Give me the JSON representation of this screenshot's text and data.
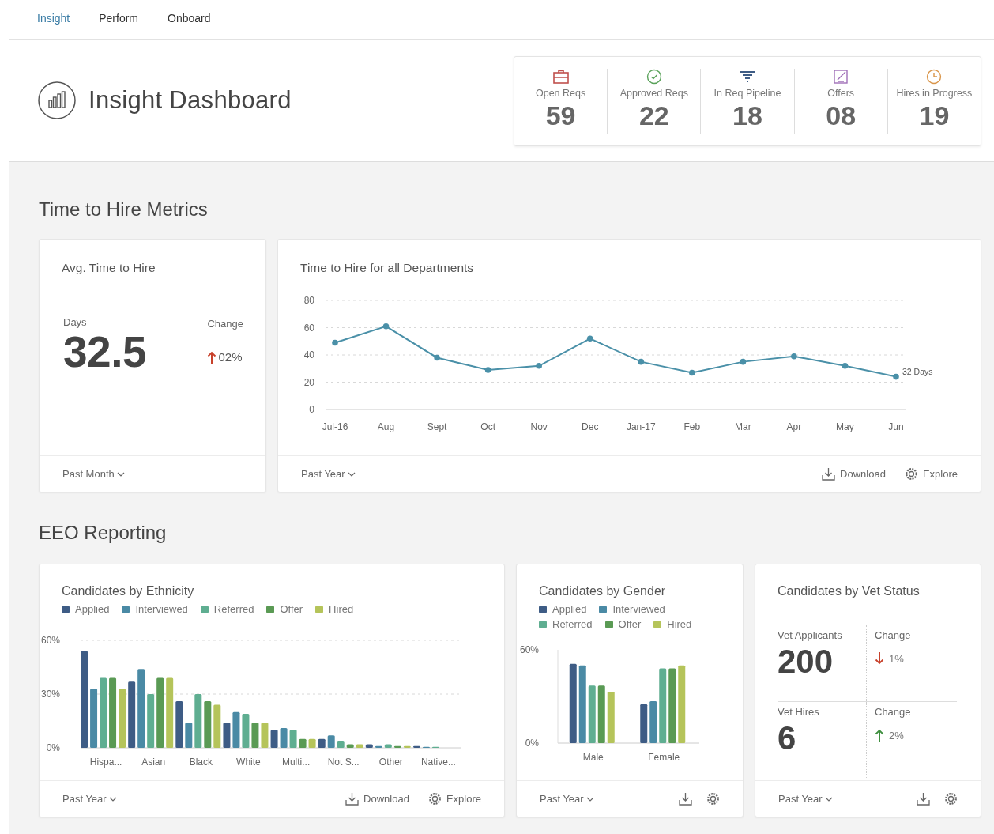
{
  "nav": {
    "tabs": [
      {
        "label": "Insight",
        "selected": true
      },
      {
        "label": "Perform",
        "selected": false
      },
      {
        "label": "Onboard",
        "selected": false
      }
    ]
  },
  "header": {
    "title": "Insight Dashboard"
  },
  "kpis": [
    {
      "label": "Open Reqs",
      "value": "59"
    },
    {
      "label": "Approved Reqs",
      "value": "22"
    },
    {
      "label": "In Req Pipeline",
      "value": "18"
    },
    {
      "label": "Offers",
      "value": "08"
    },
    {
      "label": "Hires in Progress",
      "value": "19"
    }
  ],
  "time_to_hire": {
    "heading": "Time to Hire Metrics",
    "avg": {
      "title": "Avg. Time to Hire",
      "value_label": "Days",
      "value": "32.5",
      "change_label": "Change",
      "change": "02%",
      "kind": "rise",
      "color": "#c8412b",
      "period": "Past Month"
    },
    "departments": {
      "title": "Time to Hire for all Departments",
      "period": "Past Year",
      "actions": [
        "Download",
        "Explore"
      ],
      "chart_data": {
        "type": "line",
        "categories": [
          "Jul-16",
          "Aug",
          "Sept",
          "Oct",
          "Nov",
          "Dec",
          "Jan-17",
          "Feb",
          "Mar",
          "Apr",
          "May",
          "Jun"
        ],
        "series": [
          {
            "color": "#4a90a8",
            "marker": "circle",
            "values": [
              49,
              61,
              38,
              29,
              32,
              52,
              35,
              27,
              35,
              39,
              32,
              24
            ]
          }
        ],
        "grid": true,
        "ylim": [
          0,
          80
        ],
        "yticks": [
          0,
          20,
          40,
          60,
          80
        ],
        "annotations": [
          "32 Days"
        ]
      }
    }
  },
  "eeo": {
    "heading": "EEO Reporting",
    "ethnicity": {
      "title": "Candidates by Ethnicity",
      "period": "Past Year",
      "actions": [
        "Download",
        "Explore"
      ],
      "chart_data": {
        "type": "bar",
        "categories": [
          "Hispa...",
          "Asian",
          "Black",
          "White",
          "Multi...",
          "Not S...",
          "Other",
          "Native..."
        ],
        "series": [
          {
            "name": "Applied",
            "color": "#3e5c85",
            "values": [
              54,
              37,
              26,
              14,
              10,
              5,
              2,
              1
            ]
          },
          {
            "name": "Interviewed",
            "color": "#4a8aa5",
            "values": [
              33,
              44,
              14,
              20,
              11,
              7,
              1,
              0.5
            ]
          },
          {
            "name": "Referred",
            "color": "#5fae91",
            "values": [
              39,
              30,
              30,
              19,
              10,
              4,
              2,
              0.5
            ]
          },
          {
            "name": "Offer",
            "color": "#5a9a54",
            "values": [
              39,
              39,
              26,
              14,
              5,
              2,
              1,
              0
            ]
          },
          {
            "name": "Hired",
            "color": "#b5c45a",
            "values": [
              33,
              39,
              24,
              14,
              5,
              2,
              1,
              0
            ]
          }
        ],
        "ylim": [
          0,
          60
        ],
        "yticks": [
          {
            "value": 0,
            "label": "0%"
          },
          {
            "value": 30,
            "label": "30%"
          },
          {
            "value": 60,
            "label": "60%"
          }
        ]
      }
    },
    "gender": {
      "title": "Candidates by Gender",
      "period": "Past Year",
      "chart_data": {
        "type": "bar",
        "categories": [
          "Male",
          "Female"
        ],
        "series": [
          {
            "name": "Applied",
            "color": "#3e5c85",
            "values": [
              51,
              25
            ]
          },
          {
            "name": "Interviewed",
            "color": "#4a8aa5",
            "values": [
              50,
              27
            ]
          },
          {
            "name": "Referred",
            "color": "#5fae91",
            "values": [
              37,
              48
            ]
          },
          {
            "name": "Offer",
            "color": "#5a9a54",
            "values": [
              37,
              48
            ]
          },
          {
            "name": "Hired",
            "color": "#b5c45a",
            "values": [
              33,
              50
            ]
          }
        ],
        "ylim": [
          0,
          60
        ],
        "yticks": [
          {
            "value": 0,
            "label": "0%"
          },
          {
            "value": 60,
            "label": "60%"
          }
        ]
      }
    },
    "vet": {
      "title": "Candidates by Vet Status",
      "period": "Past Year",
      "stats": [
        {
          "label": "Vet Applicants",
          "value": "200",
          "change_label": "Change",
          "change": "1%",
          "kind": "fall",
          "color": "#c8412b"
        },
        {
          "label": "Vet Hires",
          "value": "6",
          "change_label": "Change",
          "change": "2%",
          "kind": "rise",
          "color": "#3f8f3f"
        }
      ]
    }
  }
}
